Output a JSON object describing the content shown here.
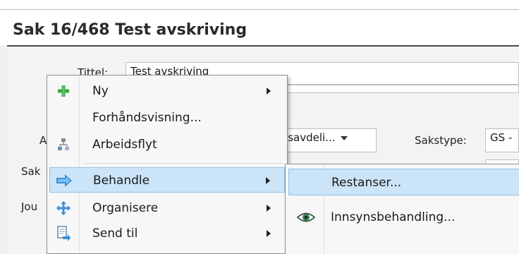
{
  "window": {
    "title": "Sak 16/468 Test avskriving"
  },
  "form": {
    "tittel_label": "Tittel:",
    "tittel_value": "Test avskriving",
    "a_label": "A",
    "sak_label": "Sak",
    "jou_label": "Jou",
    "dropdown_value": "asavdeli...",
    "sakstype_label": "Sakstype:",
    "sakstype_value": "GS -"
  },
  "context_menu": {
    "items": [
      {
        "label": "Ny",
        "icon": "plus-icon",
        "has_submenu": true
      },
      {
        "label": "Forhåndsvisning...",
        "icon": "",
        "has_submenu": false
      },
      {
        "label": "Arbeidsflyt",
        "icon": "workflow-icon",
        "has_submenu": false
      },
      {
        "label": "Behandle",
        "icon": "process-arrow-icon",
        "has_submenu": true,
        "highlighted": true
      },
      {
        "label": "Organisere",
        "icon": "move-arrows-icon",
        "has_submenu": true
      },
      {
        "label": "Send til",
        "icon": "send-icon",
        "has_submenu": true
      }
    ]
  },
  "submenu": {
    "items": [
      {
        "label": "Restanser...",
        "icon": "",
        "highlighted": true
      },
      {
        "label": "Innsynsbehandling...",
        "icon": "eye-icon"
      }
    ]
  },
  "colors": {
    "highlight_bg": "#cce4f7",
    "highlight_border": "#90c1e9",
    "plus_green": "#3aa648",
    "icon_blue": "#3d8fd6"
  }
}
